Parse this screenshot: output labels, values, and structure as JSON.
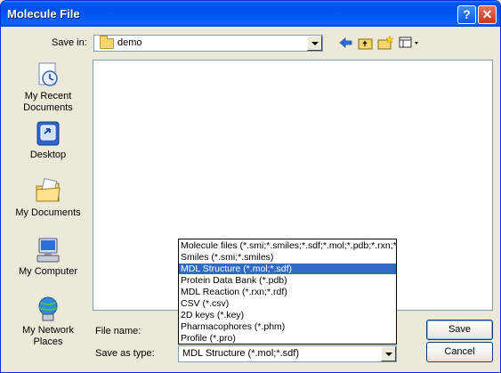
{
  "window": {
    "title": "Molecule File"
  },
  "save_in": {
    "label": "Save in:",
    "value": "demo"
  },
  "places": [
    {
      "label": "My Recent Documents",
      "icon": "recent-documents-icon"
    },
    {
      "label": "Desktop",
      "icon": "desktop-icon"
    },
    {
      "label": "My Documents",
      "icon": "my-documents-icon"
    },
    {
      "label": "My Computer",
      "icon": "my-computer-icon"
    },
    {
      "label": "My Network Places",
      "icon": "network-places-icon"
    }
  ],
  "file_name": {
    "label": "File name:",
    "value": ""
  },
  "save_as_type": {
    "label": "Save as type:",
    "value": "MDL Structure (*.mol;*.sdf)",
    "options": [
      "Molecule files (*.smi;*.smiles;*.sdf;*.mol;*.pdb;*.rxn;*",
      "Smiles (*.smi;*.smiles)",
      "MDL Structure (*.mol;*.sdf)",
      "Protein Data Bank (*.pdb)",
      "MDL Reaction (*.rxn;*.rdf)",
      "CSV (*.csv)",
      "2D keys (*.key)",
      "Pharmacophores (*.phm)",
      "Profile (*.pro)"
    ],
    "selected_index": 2
  },
  "buttons": {
    "save": "Save",
    "cancel": "Cancel"
  },
  "colors": {
    "title_bar": "#0053ee",
    "selection": "#316ac5",
    "dialog_bg": "#ece9d8"
  }
}
